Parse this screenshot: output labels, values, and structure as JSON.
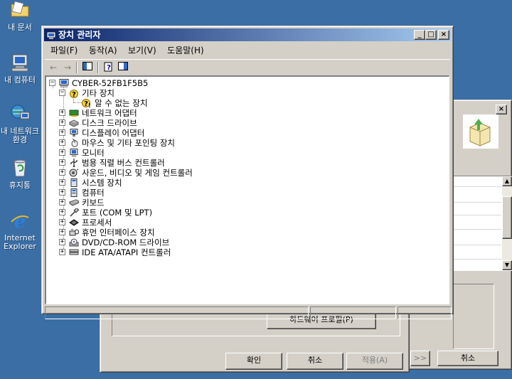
{
  "desktop": {
    "icons": [
      {
        "label": "내 문서",
        "icon": "folder-icon"
      },
      {
        "label": "내 컴퓨터",
        "icon": "computer-icon"
      },
      {
        "label": "내 네트워크 환경",
        "icon": "network-icon"
      },
      {
        "label": "휴지통",
        "icon": "recycle-bin-icon"
      },
      {
        "label": "Internet Explorer",
        "icon": "internet-explorer-icon"
      }
    ]
  },
  "device_manager": {
    "title": "장치 관리자",
    "menu": [
      "파일(F)",
      "동작(A)",
      "보기(V)",
      "도움말(H)"
    ],
    "tree": {
      "root": "CYBER-52FB1F5B5",
      "other_devices": "기타 장치",
      "unknown_device": "알 수 없는 장치",
      "categories": [
        "네트워크 어댑터",
        "디스크 드라이브",
        "디스플레이 어댑터",
        "마우스 및 기타 포인팅 장치",
        "모니터",
        "범용 직렬 버스 컨트롤러",
        "사운드, 비디오 및 게임 컨트롤러",
        "시스템 장치",
        "컴퓨터",
        "키보드",
        "포트 (COM 및 LPT)",
        "프로세서",
        "휴먼 인터페이스 장치",
        "DVD/CD-ROM 드라이브",
        "IDE ATA/ATAPI 컨트롤러"
      ]
    }
  },
  "system_properties": {
    "hardware_profiles_button": "하드웨어 프로필(P)",
    "ok_button": "확인",
    "cancel_button": "취소",
    "apply_button": "적용(A)"
  },
  "right_dialog": {
    "nav_button": ">>",
    "cancel_button": "취소"
  }
}
